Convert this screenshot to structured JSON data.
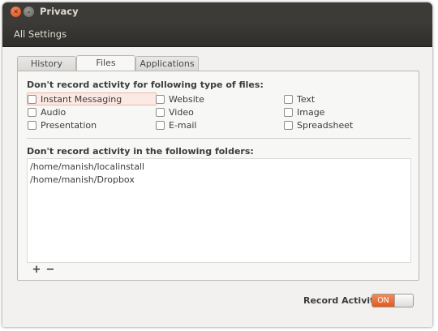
{
  "window": {
    "title": "Privacy"
  },
  "toolbar": {
    "all_settings": "All Settings"
  },
  "tabs": [
    {
      "label": "History",
      "active": false
    },
    {
      "label": "Files",
      "active": true
    },
    {
      "label": "Applications",
      "active": false
    }
  ],
  "files_section": {
    "heading": "Don't record activity for following type of files:",
    "types": [
      {
        "label": "Instant Messaging",
        "checked": false
      },
      {
        "label": "Website",
        "checked": false
      },
      {
        "label": "Text",
        "checked": false
      },
      {
        "label": "Audio",
        "checked": false
      },
      {
        "label": "Video",
        "checked": false
      },
      {
        "label": "Image",
        "checked": false
      },
      {
        "label": "Presentation",
        "checked": false
      },
      {
        "label": "E-mail",
        "checked": false
      },
      {
        "label": "Spreadsheet",
        "checked": false
      }
    ]
  },
  "folders_section": {
    "heading": "Don't record activity in the following folders:",
    "folders": [
      "/home/manish/localinstall",
      "/home/manish/Dropbox"
    ],
    "add_label": "+",
    "remove_label": "−"
  },
  "record_activity": {
    "label": "Record Activity",
    "state_label": "ON",
    "on": true
  },
  "colors": {
    "accent": "#e05a1f",
    "header": "#3c3b37"
  }
}
